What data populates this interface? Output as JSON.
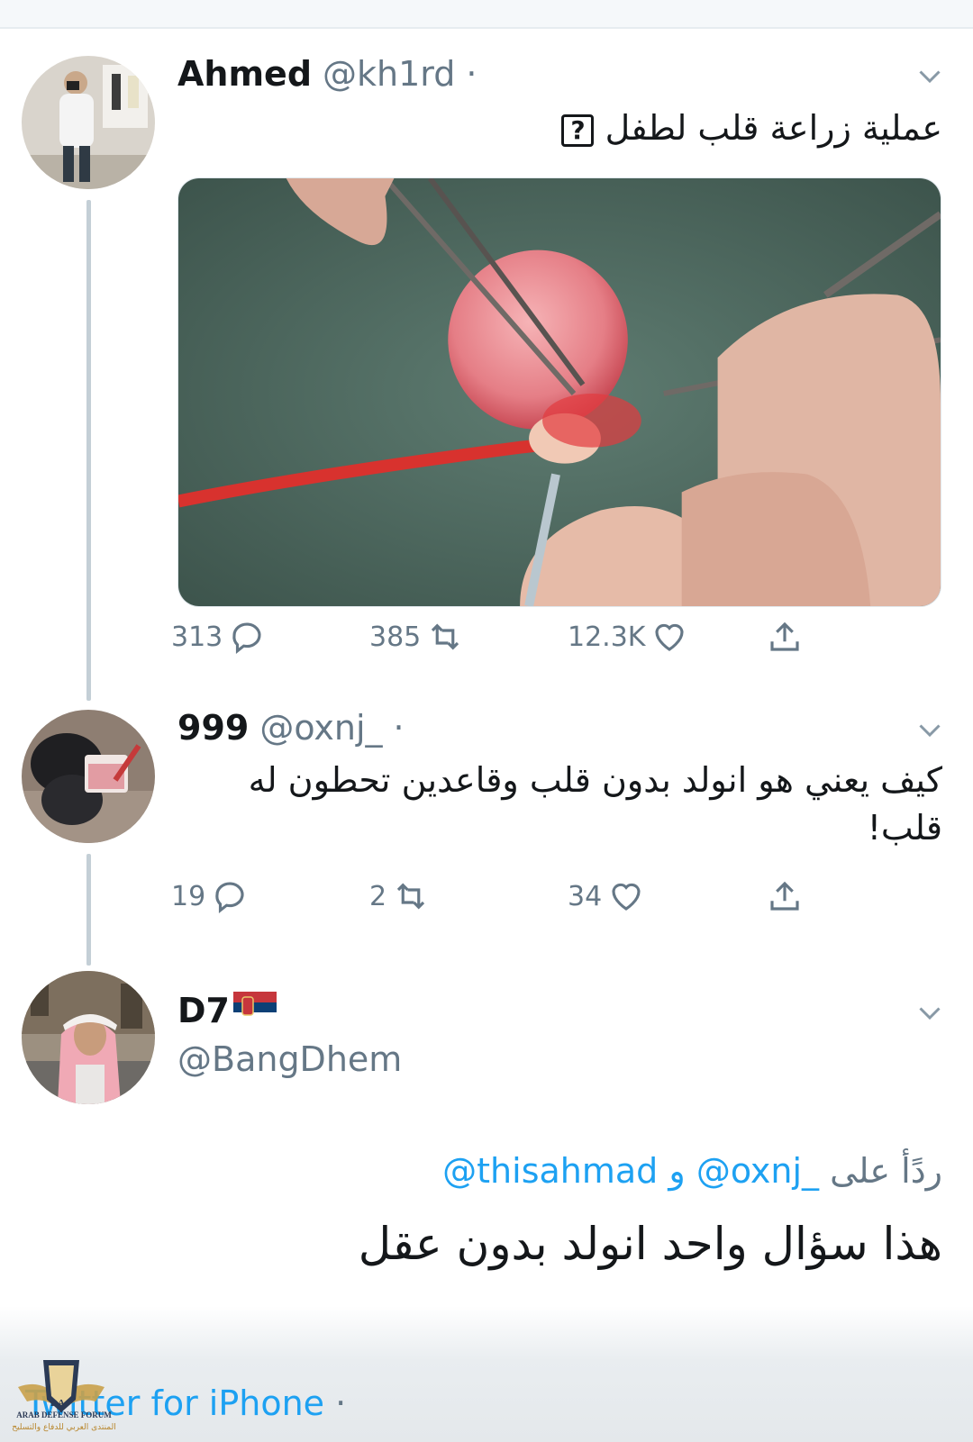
{
  "tweets": [
    {
      "name": "Ahmed",
      "handle": "@kh1rd",
      "text": "عملية زراعة قلب لطفل",
      "stats": {
        "replies": "313",
        "retweets": "385",
        "likes": "12.3K"
      }
    },
    {
      "name": "999",
      "handle": "@oxnj_",
      "text_line1": "كيف يعني هو انولد بدون قلب وقاعدين تحطون له",
      "text_line2": "قلب!",
      "stats": {
        "replies": "19",
        "retweets": "2",
        "likes": "34"
      }
    },
    {
      "name": "D7",
      "handle": "@BangDhem",
      "reply_label": "ردًأ على",
      "reply_mention1": "@oxnj_",
      "reply_and": "و",
      "reply_mention2": "@thisahmad",
      "text": "هذا سؤال واحد انولد بدون عقل"
    }
  ],
  "source_app": "Twitter for iPhone",
  "watermark": {
    "letters": "DA",
    "name_en": "ARAB DEFENSE FORUM",
    "name_ar": "المنتدى العربي للدفاع والتسليح"
  },
  "icons": {
    "reply": "reply-icon",
    "retweet": "retweet-icon",
    "like": "heart-icon",
    "share": "share-icon",
    "menu": "chevron-down-icon",
    "flag": "serbia-flag-icon"
  },
  "colors": {
    "link": "#1da1f2",
    "secondary": "#657786",
    "thread_line": "#c4cfd6"
  }
}
